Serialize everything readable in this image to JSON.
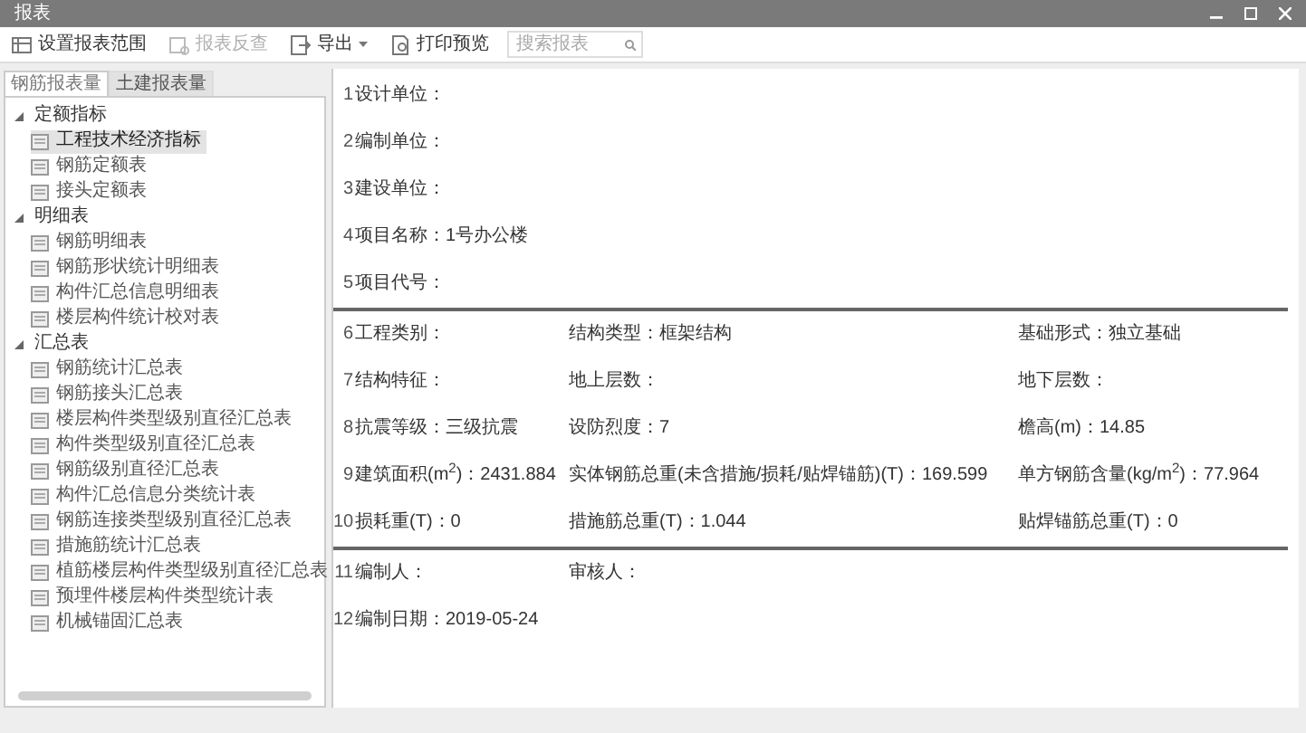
{
  "window": {
    "title": "报表"
  },
  "toolbar": {
    "buttons": [
      {
        "label": "设置报表范围",
        "kind": "button",
        "disabled": false
      },
      {
        "label": "报表反查",
        "kind": "button",
        "disabled": true
      },
      {
        "label": "导出",
        "kind": "dropdown",
        "disabled": false
      },
      {
        "label": "打印预览",
        "kind": "button",
        "disabled": false
      }
    ],
    "search": {
      "placeholder": "搜索报表"
    }
  },
  "sidebar": {
    "tabs": [
      {
        "label": "钢筋报表量",
        "selected": true
      },
      {
        "label": "土建报表量",
        "selected": false
      }
    ],
    "tree": [
      {
        "label": "定额指标",
        "expanded": true,
        "children": [
          {
            "label": "工程技术经济指标",
            "selected": true
          },
          {
            "label": "钢筋定额表",
            "selected": false
          },
          {
            "label": "接头定额表",
            "selected": false
          }
        ]
      },
      {
        "label": "明细表",
        "expanded": true,
        "children": [
          {
            "label": "钢筋明细表",
            "selected": false
          },
          {
            "label": "钢筋形状统计明细表",
            "selected": false
          },
          {
            "label": "构件汇总信息明细表",
            "selected": false
          },
          {
            "label": "楼层构件统计校对表",
            "selected": false
          }
        ]
      },
      {
        "label": "汇总表",
        "expanded": true,
        "children": [
          {
            "label": "钢筋统计汇总表",
            "selected": false
          },
          {
            "label": "钢筋接头汇总表",
            "selected": false
          },
          {
            "label": "楼层构件类型级别直径汇总表",
            "selected": false
          },
          {
            "label": "构件类型级别直径汇总表",
            "selected": false
          },
          {
            "label": "钢筋级别直径汇总表",
            "selected": false
          },
          {
            "label": "构件汇总信息分类统计表",
            "selected": false
          },
          {
            "label": "钢筋连接类型级别直径汇总表",
            "selected": false
          },
          {
            "label": "措施筋统计汇总表",
            "selected": false
          },
          {
            "label": "植筋楼层构件类型级别直径汇总表",
            "selected": false
          },
          {
            "label": "预埋件楼层构件类型统计表",
            "selected": false
          },
          {
            "label": "机械锚固汇总表",
            "selected": false
          }
        ]
      }
    ]
  },
  "report": {
    "sections": [
      {
        "rows": [
          {
            "number": "1",
            "cells": [
              "设计单位："
            ]
          },
          {
            "number": "2",
            "cells": [
              "编制单位："
            ]
          },
          {
            "number": "3",
            "cells": [
              "建设单位："
            ]
          },
          {
            "number": "4",
            "cells": [
              "项目名称：1号办公楼"
            ]
          },
          {
            "number": "5",
            "cells": [
              "项目代号："
            ]
          }
        ]
      },
      {
        "rows": [
          {
            "number": "6",
            "cells": [
              "工程类别：",
              "结构类型：框架结构",
              "基础形式：独立基础"
            ]
          },
          {
            "number": "7",
            "cells": [
              "结构特征：",
              "地上层数：",
              "地下层数："
            ]
          },
          {
            "number": "8",
            "cells": [
              "抗震等级：三级抗震",
              "设防烈度：7",
              "檐高(m)：14.85"
            ]
          },
          {
            "number": "9",
            "cells": [
              "建筑面积(m$^{2}$)：2431.884",
              "实体钢筋总重(未含措施/损耗/贴焊锚筋)(T)：169.599",
              "单方钢筋含量(kg/m$^{2}$)：77.964"
            ]
          },
          {
            "number": "10",
            "cells": [
              "损耗重(T)：0",
              "措施筋总重(T)：1.044",
              "贴焊锚筋总重(T)：0"
            ]
          }
        ]
      },
      {
        "rows": [
          {
            "number": "11",
            "cells": [
              "编制人：",
              "审核人："
            ]
          },
          {
            "number": "12",
            "cells": [
              "编制日期：2019-05-24"
            ]
          }
        ]
      }
    ]
  }
}
